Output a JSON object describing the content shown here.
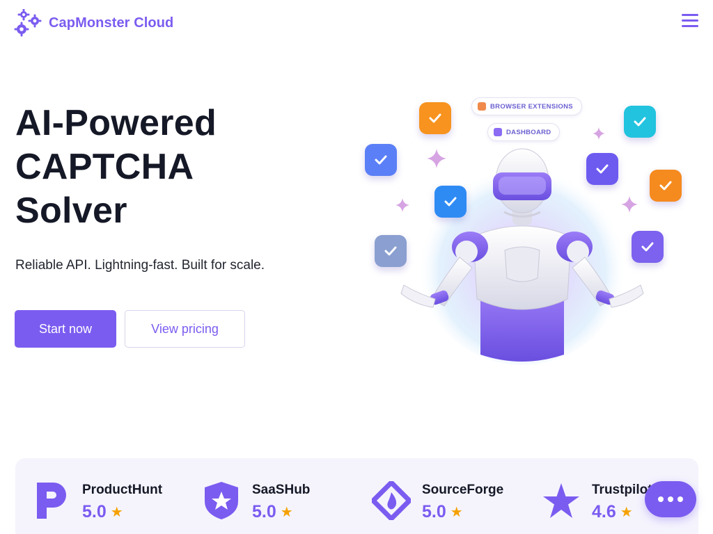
{
  "brand": {
    "name": "CapMonster Cloud",
    "accent": "#7b5cf0"
  },
  "header": {
    "menu_icon": "hamburger-icon"
  },
  "hero": {
    "title_lines": [
      "AI-Powered",
      "CAPTCHA",
      "Solver"
    ],
    "subtitle": "Reliable API. Lightning-fast. Built for scale.",
    "primary_cta": "Start now",
    "secondary_cta": "View pricing"
  },
  "illustration": {
    "pills": [
      "BROWSER EXTENSIONS",
      "DASHBOARD"
    ]
  },
  "ratings": [
    {
      "name": "ProductHunt",
      "score": "5.0",
      "icon": "producthunt-icon"
    },
    {
      "name": "SaaSHub",
      "score": "5.0",
      "icon": "saashub-icon"
    },
    {
      "name": "SourceForge",
      "score": "5.0",
      "icon": "sourceforge-icon"
    },
    {
      "name": "Trustpilot",
      "score": "4.6",
      "icon": "trustpilot-icon"
    }
  ],
  "colors": {
    "star": "#f5a100",
    "heading": "#151826"
  }
}
